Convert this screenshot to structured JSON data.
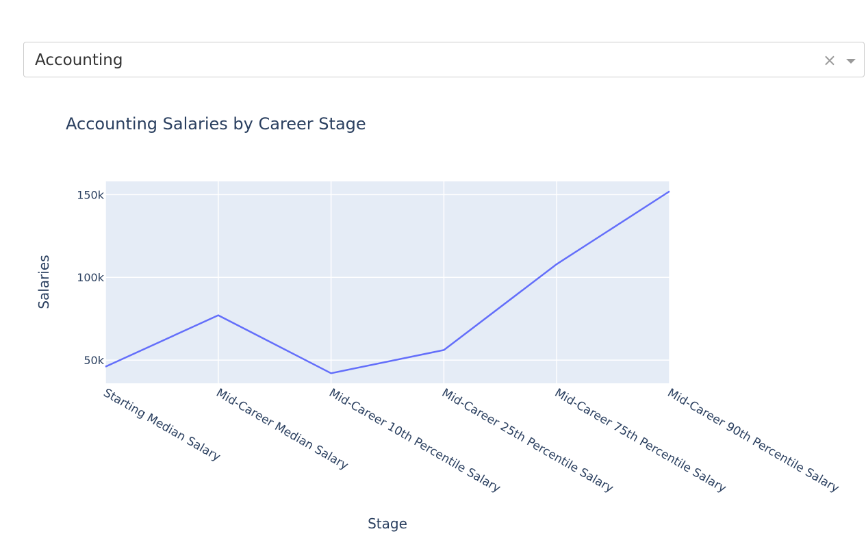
{
  "dropdown": {
    "selected": "Accounting",
    "clear_glyph": "×",
    "caret_icon": "caret-down-icon"
  },
  "colors": {
    "plot_bg": "#e5ecf6",
    "line": "#636efa",
    "text": "#2a3f5f",
    "grid": "#ffffff"
  },
  "chart_data": {
    "type": "line",
    "title": "Accounting Salaries by Career Stage",
    "xlabel": "Stage",
    "ylabel": "Salaries",
    "categories": [
      "Starting Median Salary",
      "Mid-Career Median Salary",
      "Mid-Career 10th Percentile Salary",
      "Mid-Career 25th Percentile Salary",
      "Mid-Career 75th Percentile Salary",
      "Mid-Career 90th Percentile Salary"
    ],
    "series": [
      {
        "values": [
          46000,
          77100,
          42100,
          56100,
          108000,
          152000
        ]
      }
    ],
    "yticks": [
      {
        "value": 50000,
        "label": "50k"
      },
      {
        "value": 100000,
        "label": "100k"
      },
      {
        "value": 150000,
        "label": "150k"
      }
    ],
    "ylim": [
      36000,
      158000
    ],
    "grid": true,
    "legend": "none"
  }
}
